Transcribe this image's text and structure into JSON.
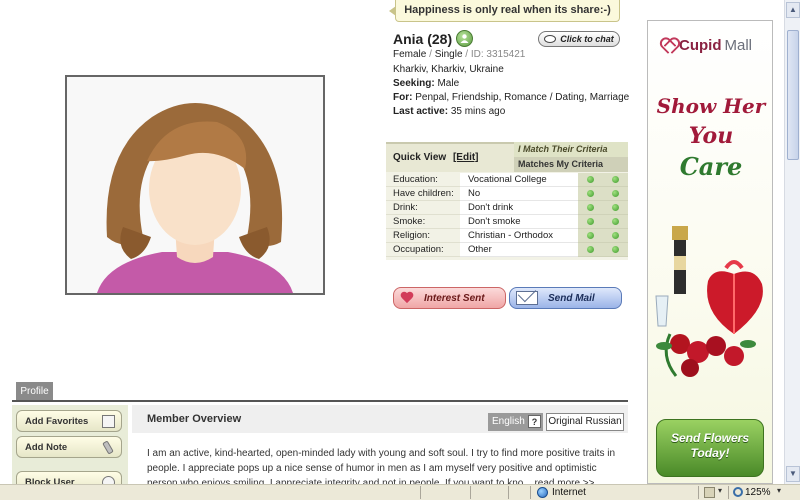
{
  "slogan": "Happiness is only real when its share:-)",
  "profile": {
    "name": "Ania (28)",
    "gender": "Female",
    "status": "Single",
    "id_label": "ID: 3315421",
    "location": "Kharkiv, Kharkiv, Ukraine",
    "seeking_label": "Seeking:",
    "seeking_value": "Male",
    "for_label": "For:",
    "for_value": "Penpal, Friendship, Romance / Dating, Marriage",
    "last_active_label": "Last active:",
    "last_active_value": "35 mins ago",
    "chat_label": "Click to chat"
  },
  "quick_view": {
    "title": "Quick View",
    "edit_label": "[Edit]",
    "col_i_match": "I Match Their Criteria",
    "col_matches_me": "Matches My Criteria",
    "rows": [
      {
        "label": "Education:",
        "value": "Vocational College"
      },
      {
        "label": "Have children:",
        "value": "No"
      },
      {
        "label": "Drink:",
        "value": "Don't drink"
      },
      {
        "label": "Smoke:",
        "value": "Don't smoke"
      },
      {
        "label": "Religion:",
        "value": "Christian - Orthodox"
      },
      {
        "label": "Occupation:",
        "value": "Other"
      }
    ]
  },
  "actions": {
    "interest_label": "Interest Sent",
    "mail_label": "Send Mail"
  },
  "tabs": {
    "profile_label": "Profile"
  },
  "side_actions": {
    "add_favorites": "Add Favorites",
    "add_note": "Add Note",
    "block_user": "Block User"
  },
  "overview": {
    "title": "Member Overview",
    "english_label": "English",
    "help_label": "?",
    "original_label": "Original Russian",
    "text": "I am an active, kind-hearted, open-minded lady with young and soft soul. I try to find more positive traits in people. I appreciate pops up a nice sense of humor in men as I am myself very positive and optimistic person who enjoys smiling. I appreciate integrity and not in people. If you want to kno... read more >>"
  },
  "ad": {
    "brand_main": "Cupid",
    "brand_sub": "Mall",
    "headline_1": "Show Her",
    "headline_2": "You",
    "headline_3": "Care",
    "cta_line1": "Send Flowers",
    "cta_line2": "Today!"
  },
  "statusbar": {
    "zone": "Internet",
    "zoom": "125%"
  },
  "colors": {
    "online_green": "#5d9c42",
    "match_dot": "#3f9a2c",
    "ad_red": "#a11a3a"
  }
}
